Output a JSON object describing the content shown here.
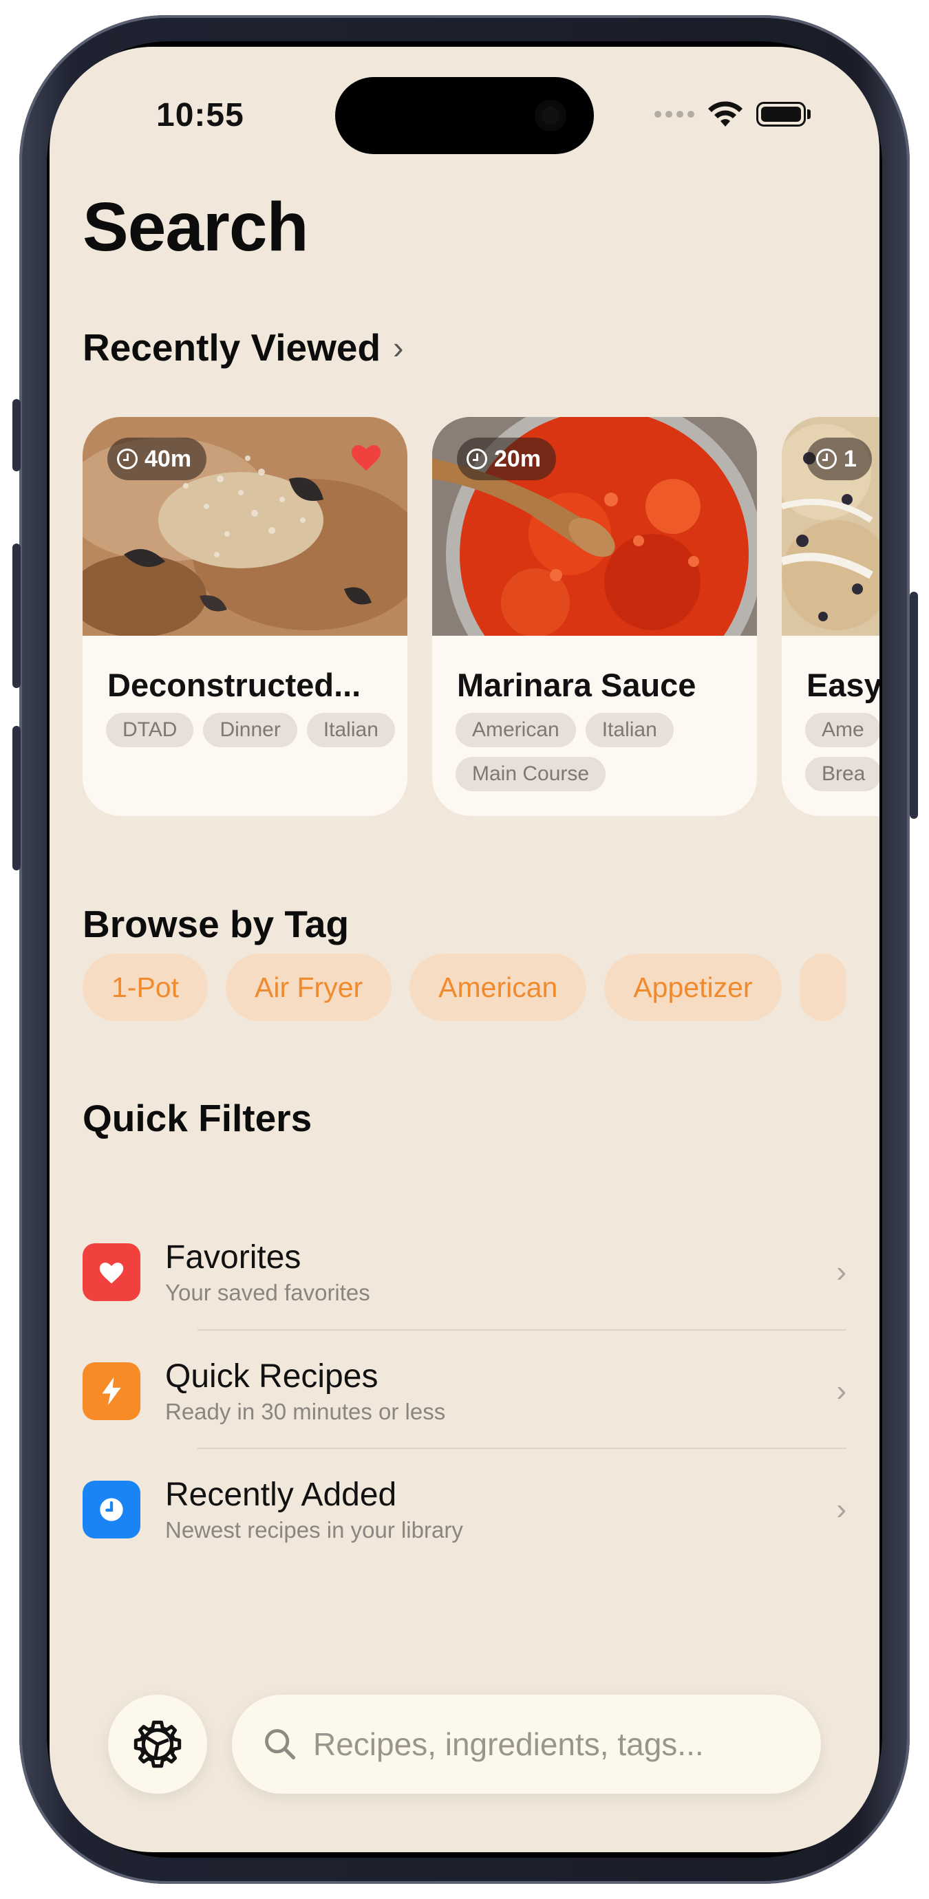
{
  "status": {
    "time": "10:55"
  },
  "page": {
    "title": "Search"
  },
  "recently_viewed": {
    "heading": "Recently Viewed",
    "cards": [
      {
        "time": "40m",
        "title": "Deconstructed...",
        "favorite": true,
        "tags": [
          "DTAD",
          "Dinner",
          "Italian"
        ]
      },
      {
        "time": "20m",
        "title": "Marinara Sauce",
        "favorite": false,
        "tags": [
          "American",
          "Italian",
          "Main Course"
        ]
      },
      {
        "time": "1",
        "title": "Easy",
        "favorite": false,
        "tags": [
          "Ame",
          "Brea"
        ]
      }
    ]
  },
  "browse_by_tag": {
    "heading": "Browse by Tag",
    "tags": [
      "1-Pot",
      "Air Fryer",
      "American",
      "Appetizer"
    ]
  },
  "quick_filters": {
    "heading": "Quick Filters",
    "items": [
      {
        "title": "Favorites",
        "subtitle": "Your saved favorites",
        "icon": "heart-icon",
        "color": "#f0413f"
      },
      {
        "title": "Quick Recipes",
        "subtitle": "Ready in 30 minutes or less",
        "icon": "bolt-icon",
        "color": "#f68b27"
      },
      {
        "title": "Recently Added",
        "subtitle": "Newest recipes in your library",
        "icon": "clock-icon",
        "color": "#1a84f5"
      }
    ]
  },
  "search": {
    "placeholder": "Recipes, ingredients, tags..."
  },
  "colors": {
    "background": "#f1e8db",
    "accent": "#f08a2c",
    "chip_bg": "#f7dcc4",
    "favorite": "#f0413f"
  }
}
